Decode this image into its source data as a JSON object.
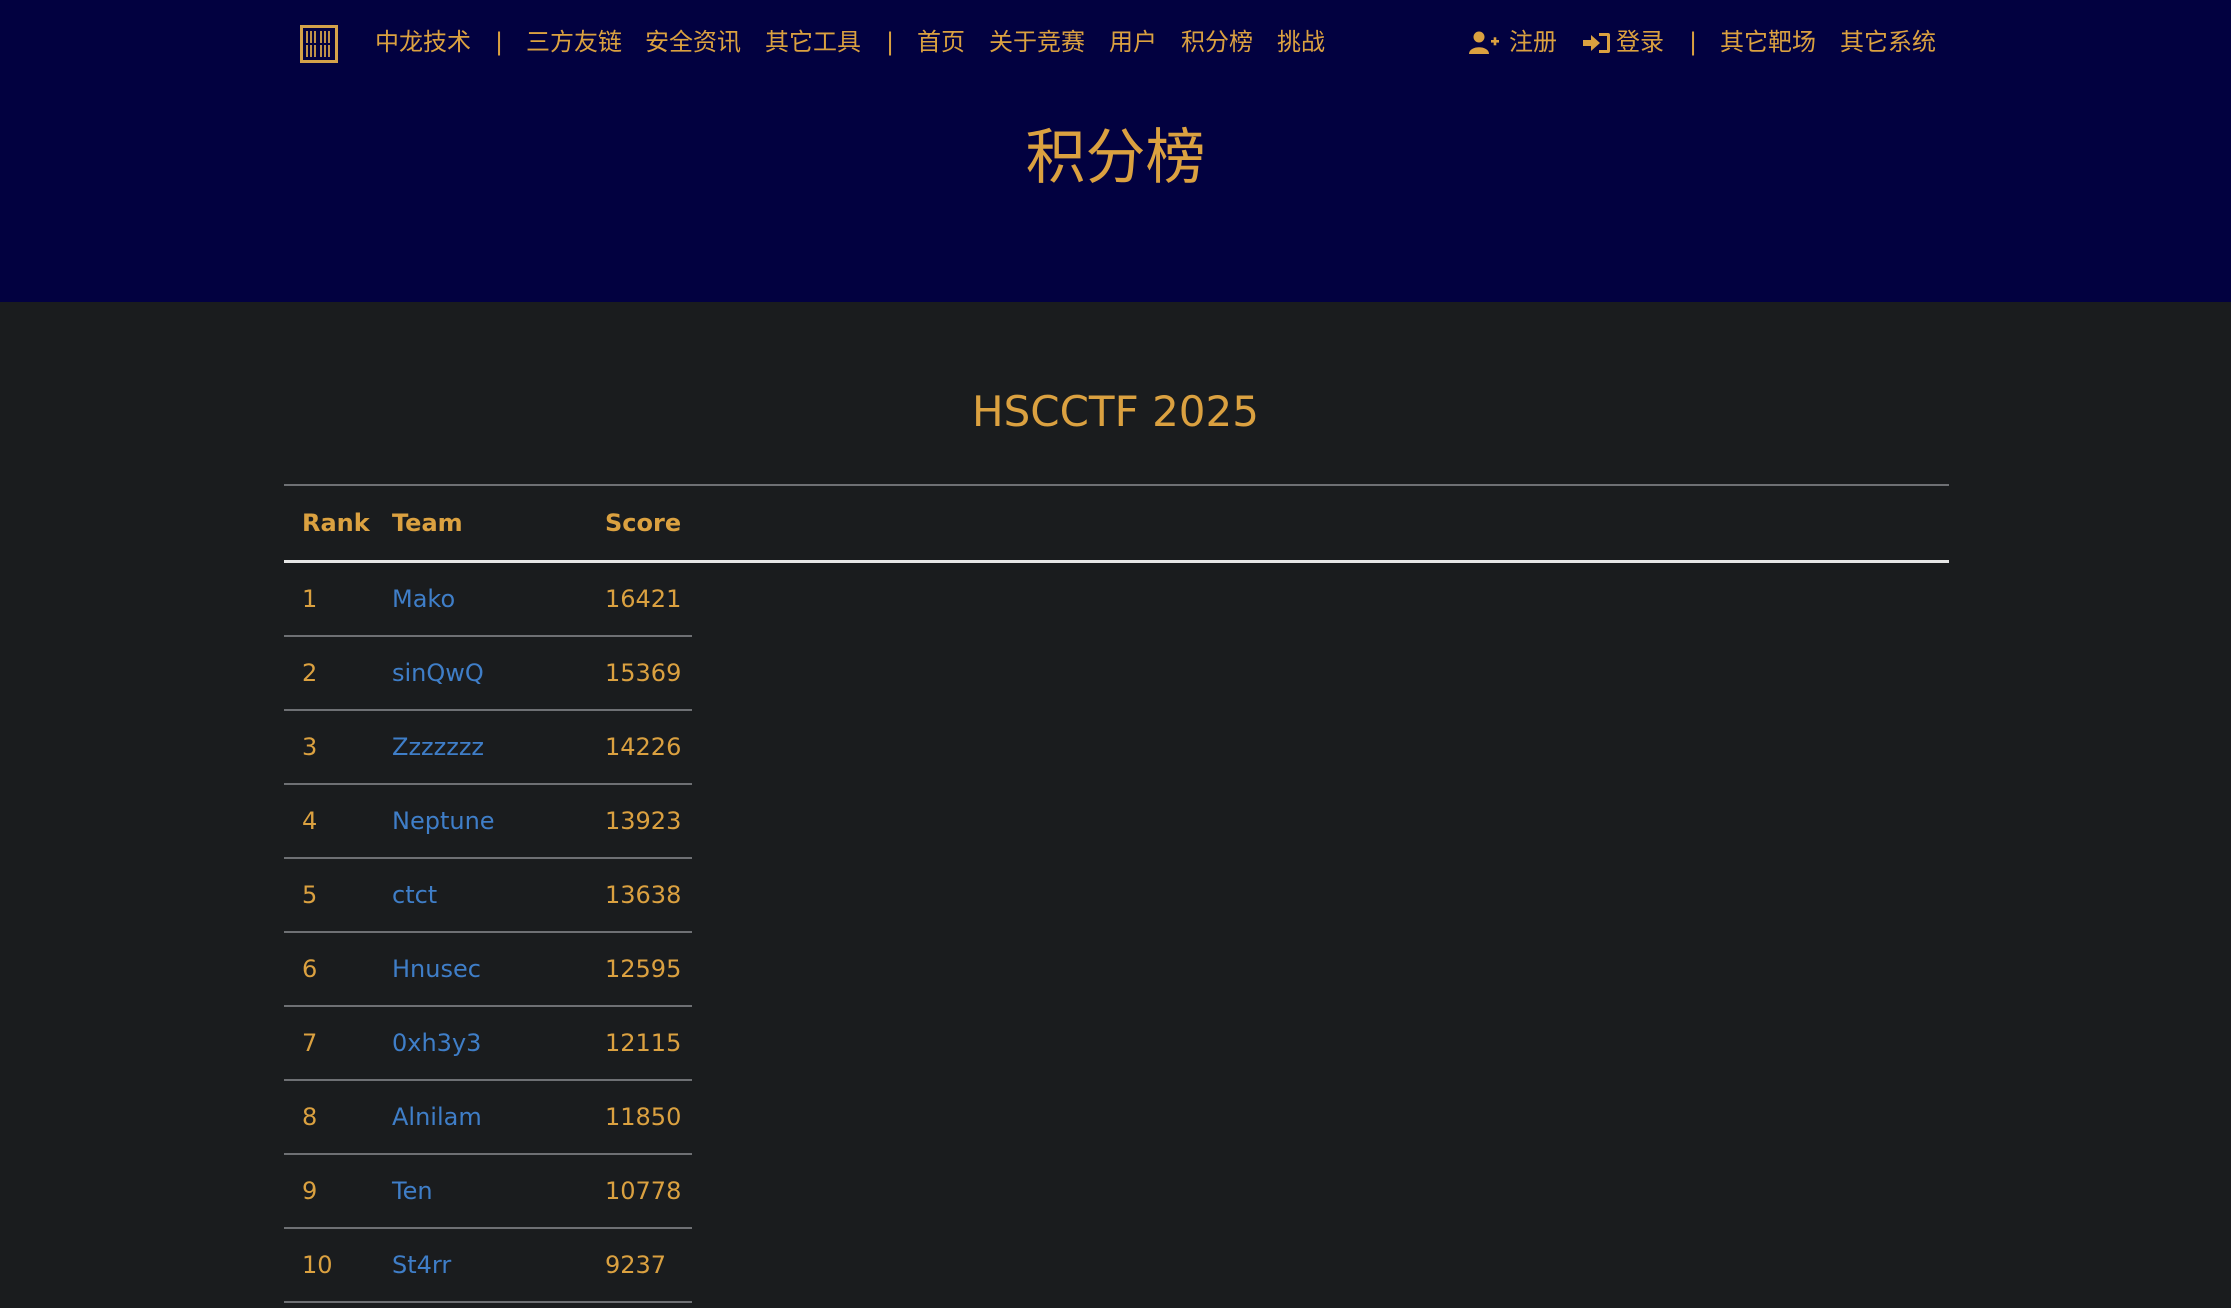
{
  "colors": {
    "header_bg": "#020140",
    "body_bg": "#1a1c1e",
    "accent": "#dba140",
    "link": "#3f7ec8"
  },
  "nav": {
    "left_items": [
      "中龙技术",
      "三方友链",
      "安全资讯",
      "其它工具",
      "首页",
      "关于竞赛",
      "用户",
      "积分榜",
      "挑战"
    ],
    "separator": "|",
    "register": "注册",
    "login": "登录",
    "right_items": [
      "其它靶场",
      "其它系统"
    ],
    "icons": [
      "logo-seal-icon",
      "user-plus-icon",
      "sign-in-icon"
    ]
  },
  "page_title": "积分榜",
  "ctf_title": "HSCCTF 2025",
  "table": {
    "headers": [
      "Rank",
      "Team",
      "Score"
    ],
    "rows": [
      {
        "rank": "1",
        "team": "Mako",
        "score": "16421"
      },
      {
        "rank": "2",
        "team": "sinQwQ",
        "score": "15369"
      },
      {
        "rank": "3",
        "team": "Zzzzzzz",
        "score": "14226"
      },
      {
        "rank": "4",
        "team": "Neptune",
        "score": "13923"
      },
      {
        "rank": "5",
        "team": "ctct",
        "score": "13638"
      },
      {
        "rank": "6",
        "team": "Hnusec",
        "score": "12595"
      },
      {
        "rank": "7",
        "team": "0xh3y3",
        "score": "12115"
      },
      {
        "rank": "8",
        "team": "Alnilam",
        "score": "11850"
      },
      {
        "rank": "9",
        "team": "Ten",
        "score": "10778"
      },
      {
        "rank": "10",
        "team": "St4rr",
        "score": "9237"
      }
    ]
  }
}
